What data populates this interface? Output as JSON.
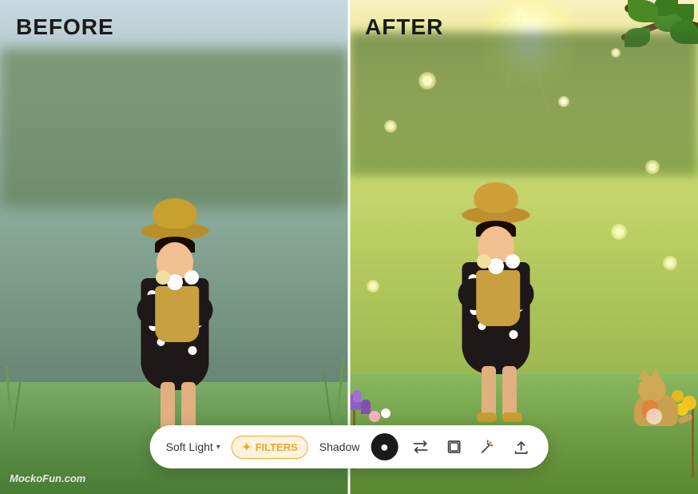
{
  "before_label": "BEFORE",
  "after_label": "AFTER",
  "watermark": "MockoFun.com",
  "toolbar": {
    "soft_light_label": "Soft Light",
    "dropdown_arrow": "▾",
    "filters_label": "FILTERS",
    "filters_star": "✦",
    "shadow_label": "Shadow",
    "circle_icon": "●",
    "swap_icon": "⇄",
    "layers_icon": "⧉",
    "wand_icon": "✦",
    "upload_icon": "↑"
  },
  "colors": {
    "filters_accent": "#f5a623",
    "toolbar_bg": "#ffffff",
    "circle_bg": "#1a1a1a"
  }
}
